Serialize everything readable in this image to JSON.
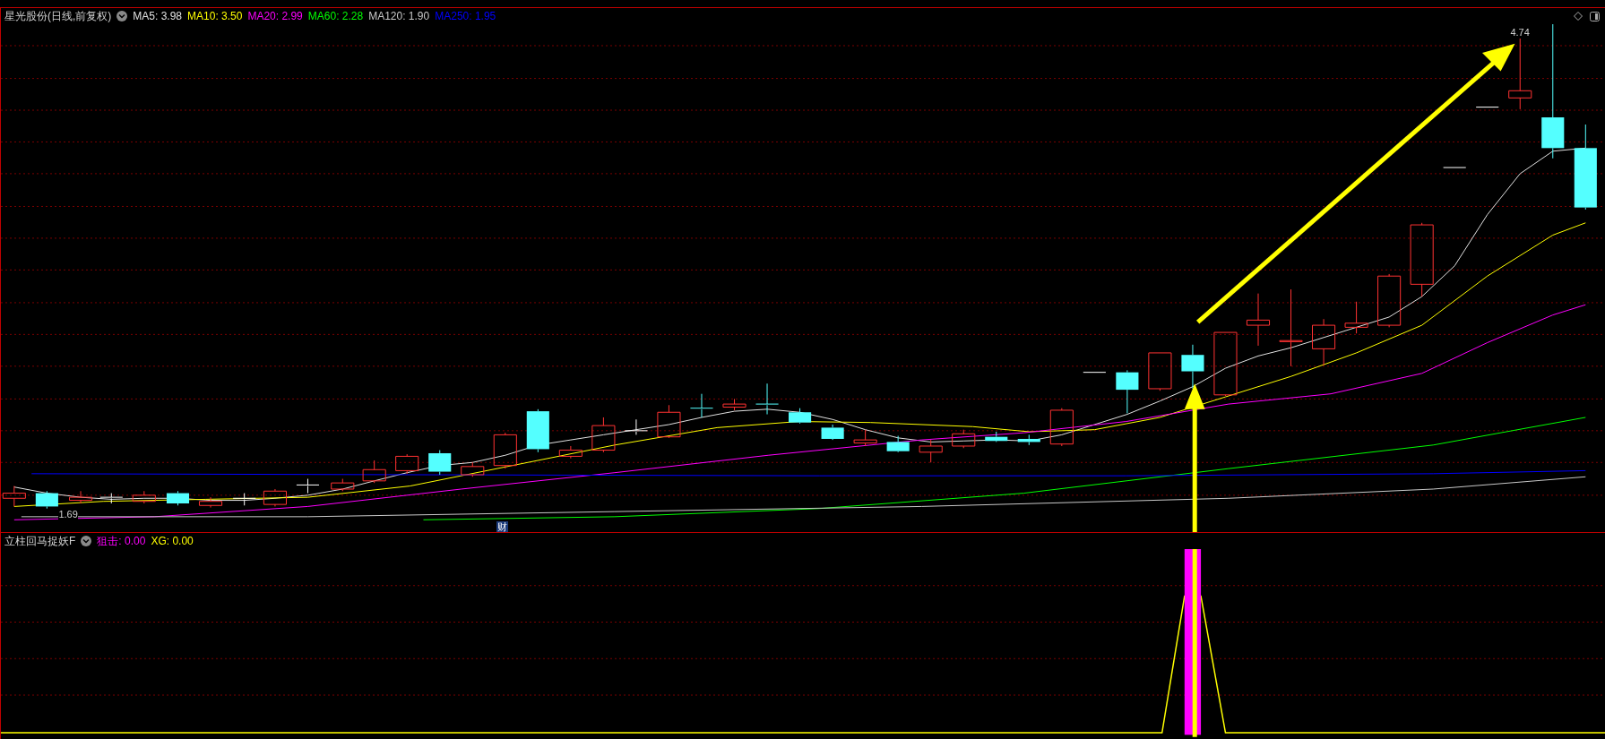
{
  "main_chart": {
    "title": "星光股份(日线,前复权)",
    "indicators": [
      {
        "label": "MA5: 3.98",
        "color": "#e0e0e0"
      },
      {
        "label": "MA10: 3.50",
        "color": "#ffff00"
      },
      {
        "label": "MA20: 2.99",
        "color": "#ff00ff"
      },
      {
        "label": "MA60: 2.28",
        "color": "#00ff00"
      },
      {
        "label": "MA120: 1.90",
        "color": "#c8c8c8"
      },
      {
        "label": "MA250: 1.95",
        "color": "#0000ff"
      }
    ],
    "high_label": "4.74",
    "low_label": "1.69",
    "event_badge": "财"
  },
  "sub_chart": {
    "title": "立柱回马捉妖F",
    "indicators": [
      {
        "label": "狙击: 0.00",
        "color": "#ff00ff"
      },
      {
        "label": "XG: 0.00",
        "color": "#ffff00"
      }
    ]
  }
}
